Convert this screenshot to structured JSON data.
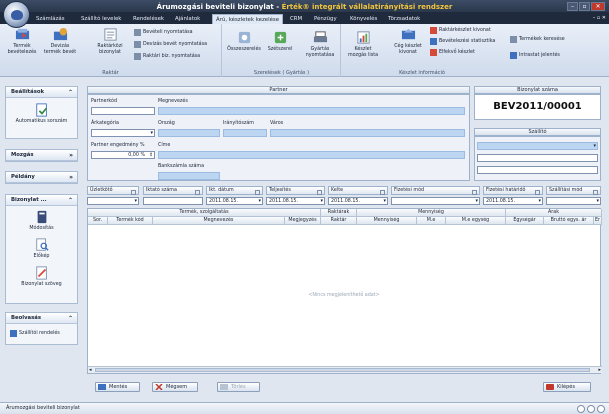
{
  "app": {
    "title_main": "Árumozgási beviteli bizonylat - ",
    "title_accent": "Érték® integrált vállalatirányítási rendszer"
  },
  "menu_tabs": [
    "Számlázás",
    "Szállító levelek",
    "Rendelések",
    "Ajánlatok",
    "Árú, készletek kezelése",
    "CRM",
    "Pénzügy",
    "Könyvelés",
    "Törzsadatok"
  ],
  "ribbon_right": "– ▫ ✕",
  "ribbon": {
    "raktar": {
      "label": "Raktár",
      "termek_bevetelezes": "Termék bevételezés",
      "devizas_termek_bevet": "Devizás termék bevét",
      "raktarkozi_bizonylat": "Raktárközi bizonylat",
      "beveteli_nyomtatasa": "Bevételi nyomtatása",
      "devizas_bevet_nyomtatasa": "Devizás bevét nyomtatása",
      "raktari_biz_nyomtatasa": "Raktári biz. nyomtatása"
    },
    "szereles": {
      "label": "Szerelések ( Gyártás )",
      "osszeszereles": "Összeszerelés",
      "szetszereles": "Szétszerel",
      "gyartas_nyomtatasa": "Gyártás nyomtatása"
    },
    "keszlet": {
      "label": "Készlet információ",
      "keszlet_mozgas_lista": "Készlet mozgás lista",
      "ceg_keszlet_kivonat": "Cég készlet kivonat",
      "raktarkeszlet_kivonat": "Raktárkészlet kivonat",
      "bevetelezesi_statisztika": "Bevételezési statisztika",
      "elfekvo_keszlet": "Elfekvő készlet",
      "termekek_keresese": "Termékek keresése",
      "intrastat_jelentes": "Intrastat jelentés"
    }
  },
  "sidebar": {
    "beallitasok": {
      "title": "Beállítások",
      "item": "Automatikus sorszám"
    },
    "mozgas": {
      "title": "Mozgás"
    },
    "peldany": {
      "title": "Példány"
    },
    "bizonylat": {
      "title": "Bizonylat ...",
      "items": [
        "Módosítás",
        "Előkép",
        "Bizonylat szöveg"
      ]
    },
    "beolvasas": {
      "title": "Beolvasás",
      "item": "Szállítói rendelés"
    }
  },
  "partner": {
    "section": "Partner",
    "partnerkod": "Partnerkód",
    "megnevezes": "Megnevezés",
    "arkategoria": "Árkategória",
    "orszag": "Ország",
    "iranyitoszam": "Irányítószám",
    "varos": "Város",
    "engedmeny_label": "Partner engedmény %",
    "engedmeny_value": "0,00 %",
    "cime": "Címe",
    "bankszamla": "Bankszámla száma"
  },
  "bizonylat": {
    "label": "Bizonylat száma",
    "value": "BEV2011/00001"
  },
  "szallito": {
    "label": "Szállító"
  },
  "fields": {
    "uzletkoto": "Üzletkötő",
    "iktato": "Iktató száma",
    "ikt_datum": "Ikt. dátum",
    "ikt_datum_val": "2011.08.15.",
    "teljesites": "Teljesítés",
    "teljesites_val": "2011.08.15.",
    "kelte": "Kelte",
    "kelte_val": "2011.08.15.",
    "fizetesi_mod": "Fizetési mód",
    "fizetesi_hatarido": "Fizetési határidő",
    "fizetesi_hatarido_val": "2011.08.15.",
    "szallitasi_mod": "Szállítási mód"
  },
  "grid": {
    "group_headers": {
      "termek": "Termék, szolgáltatás",
      "raktarak": "Raktárak",
      "mennyiseg": "Mennyiség",
      "arak": "Árak"
    },
    "columns": [
      "Sor.",
      "Termék kód",
      "Megnevezés",
      "Megjegyzés",
      "Raktár",
      "Mennyiség",
      "M.e",
      "M.e egység",
      "Egységár",
      "Bruttó egys. ár",
      "Er"
    ],
    "empty": "<Nincs megjeleníthető adat>"
  },
  "actions": {
    "mentes": "Mentés",
    "megsem": "Mégsem",
    "torles": "Törlés",
    "kilepes": "Kilépés"
  },
  "status": {
    "tab": "Árumozgási beviteli bizonylat"
  }
}
